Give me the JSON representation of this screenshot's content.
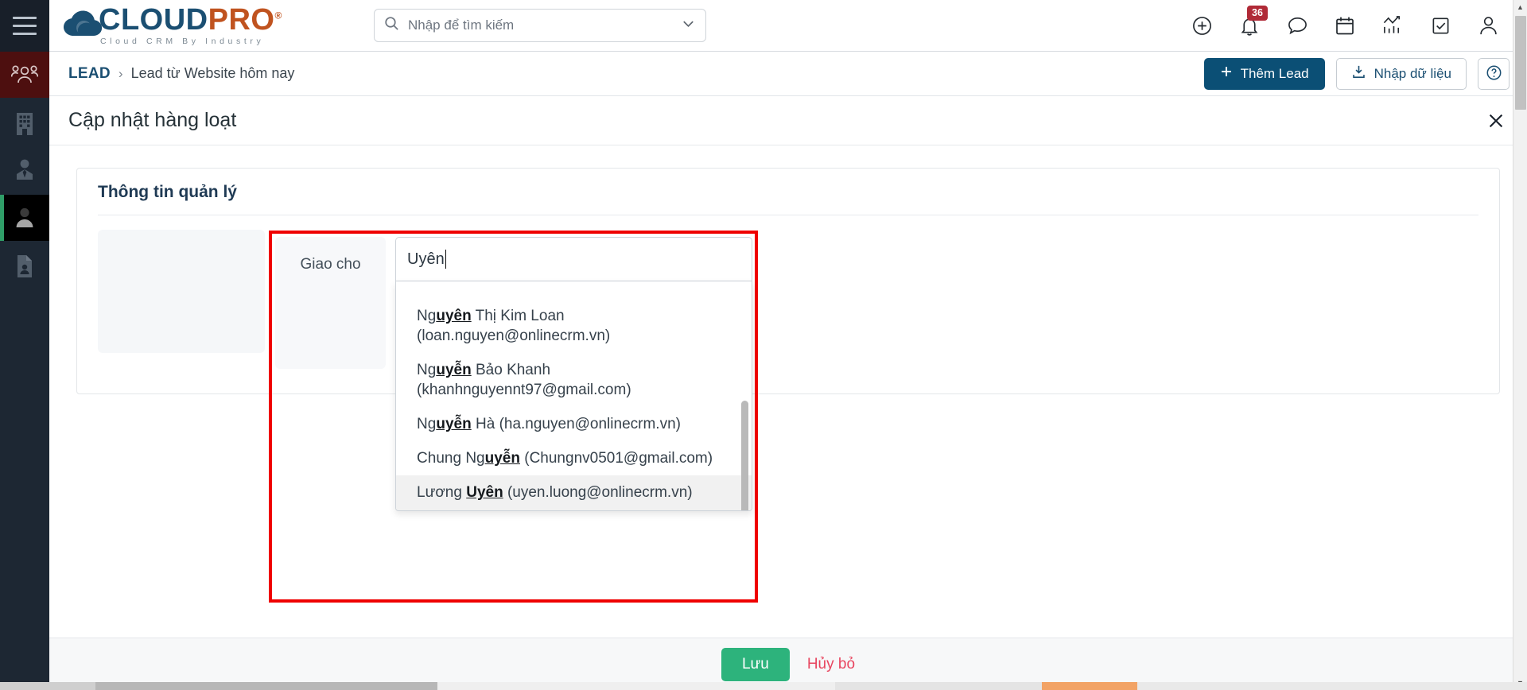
{
  "brand": {
    "name_first": "CLOUD",
    "name_second": "PRO",
    "registered": "®",
    "tagline": "Cloud CRM By Industry"
  },
  "search": {
    "placeholder": "Nhập để tìm kiếm",
    "icon": "search-icon",
    "chevron": "chevron-down-icon"
  },
  "topbar": {
    "icons": [
      {
        "name": "add-circle-icon",
        "label": ""
      },
      {
        "name": "notifications-bell-icon",
        "label": "",
        "badge": "36"
      },
      {
        "name": "chat-bubble-icon",
        "label": ""
      },
      {
        "name": "calendar-icon",
        "label": ""
      },
      {
        "name": "analytics-chart-icon",
        "label": ""
      },
      {
        "name": "tasks-checkbox-icon",
        "label": ""
      },
      {
        "name": "user-account-icon",
        "label": ""
      }
    ],
    "notification_count": "36"
  },
  "sidebar": {
    "items": [
      {
        "name": "sidebar-item-leads",
        "icon": "people-group-icon",
        "state": "active-red"
      },
      {
        "name": "sidebar-item-companies",
        "icon": "building-icon",
        "state": "idle"
      },
      {
        "name": "sidebar-item-contacts",
        "icon": "contact-tie-icon",
        "state": "idle"
      },
      {
        "name": "sidebar-item-customers",
        "icon": "person-icon",
        "state": "active-black"
      },
      {
        "name": "sidebar-item-documents",
        "icon": "document-person-icon",
        "state": "idle"
      }
    ]
  },
  "breadcrumb": {
    "root": "LEAD",
    "separator": "›",
    "current": "Lead từ Website hôm nay",
    "add_lead": "Thêm Lead",
    "import": "Nhập dữ liệu",
    "help": "?"
  },
  "modal": {
    "title": "Cập nhật hàng loạt",
    "close_icon": "close-icon",
    "section_title": "Thông tin quản lý",
    "assign": {
      "label": "Giao cho",
      "value": "Uyên",
      "options": [
        {
          "prefix": "Ng",
          "match": "uyên",
          "suffix": " Thị Kim Loan",
          "email": "(loan.nguyen@onlinecrm.vn)",
          "selected": false
        },
        {
          "prefix": "Ng",
          "match": "uyễn",
          "suffix": " Bảo Khanh",
          "email": "(khanhnguyennt97@gmail.com)",
          "selected": false
        },
        {
          "prefix": "Ng",
          "match": "uyễn",
          "suffix": " Hà",
          "email": "(ha.nguyen@onlinecrm.vn)",
          "selected": false
        },
        {
          "prefix": "Chung Ng",
          "match": "uyễn",
          "suffix": "",
          "email": "(Chungnv0501@gmail.com)",
          "selected": false
        },
        {
          "prefix": "Lương ",
          "match": "Uyên",
          "suffix": "",
          "email": "(uyen.luong@onlinecrm.vn)",
          "selected": true
        }
      ]
    },
    "save": "Lưu",
    "cancel": "Hủy bỏ"
  },
  "colors": {
    "brand_blue": "#1b4f72",
    "brand_orange": "#c0531f",
    "primary_button": "#0b4f75",
    "save_green": "#2db37c",
    "cancel_red": "#e8455f",
    "badge_red": "#b02a37",
    "annotation_red": "#ef0000",
    "rail_dark": "#1d2733",
    "rail_active_red": "#4d0f0f",
    "rail_active_green": "#2f9e68"
  }
}
